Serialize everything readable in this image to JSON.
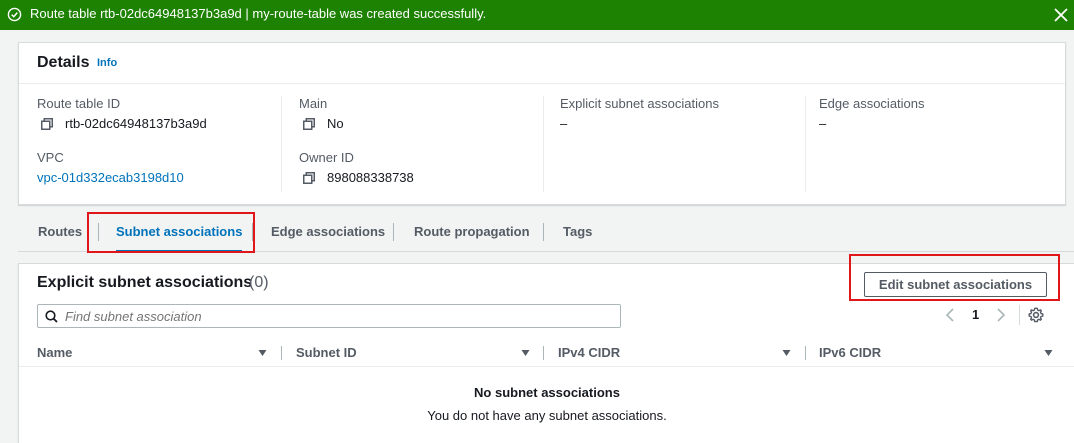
{
  "banner": {
    "message": "Route table rtb-02dc64948137b3a9d | my-route-table was created successfully.",
    "color": "#1d8102"
  },
  "details": {
    "title": "Details",
    "info": "Info",
    "route_table_id_label": "Route table ID",
    "route_table_id": "rtb-02dc64948137b3a9d",
    "main_label": "Main",
    "main": "No",
    "explicit_label": "Explicit subnet associations",
    "explicit": "–",
    "edge_label": "Edge associations",
    "edge": "–",
    "vpc_label": "VPC",
    "vpc": "vpc-01d332ecab3198d10",
    "owner_label": "Owner ID",
    "owner": "898088338738"
  },
  "tabs": [
    {
      "label": "Routes"
    },
    {
      "label": "Subnet associations",
      "active": true
    },
    {
      "label": "Edge associations"
    },
    {
      "label": "Route propagation"
    },
    {
      "label": "Tags"
    }
  ],
  "assoc": {
    "title": "Explicit subnet associations",
    "count": "(0)",
    "edit_button": "Edit subnet associations",
    "search_placeholder": "Find subnet association",
    "page": "1",
    "columns": [
      "Name",
      "Subnet ID",
      "IPv4 CIDR",
      "IPv6 CIDR"
    ],
    "empty_title": "No subnet associations",
    "empty_message": "You do not have any subnet associations."
  },
  "colors": {
    "accent": "#0073bb",
    "highlight": "#e0161b"
  }
}
